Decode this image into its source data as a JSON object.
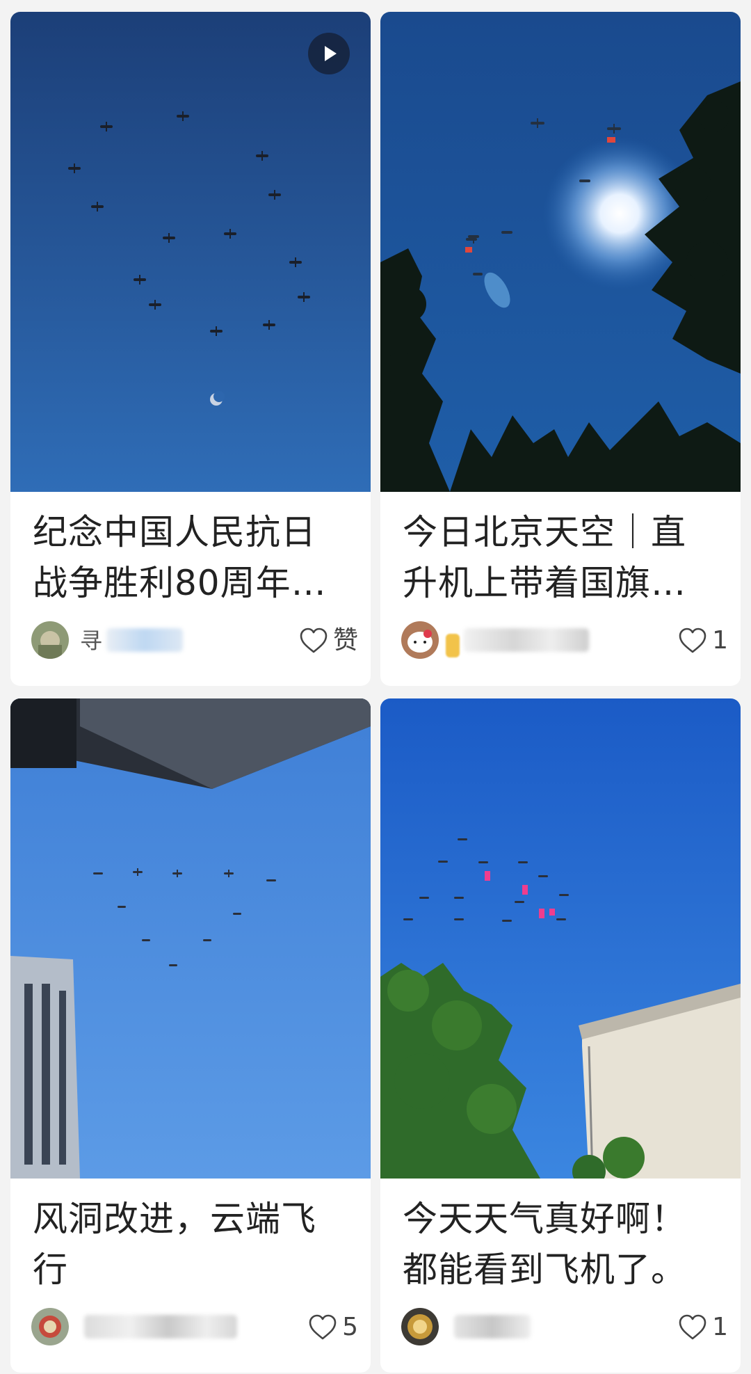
{
  "cards": [
    {
      "title_lines": [
        "纪念中国人民抗日",
        "战争胜利80周年…"
      ],
      "author": "寻",
      "like_label": "赞",
      "has_video": true
    },
    {
      "title_lines": [
        "今日北京天空｜直",
        "升机上带着国旗…"
      ],
      "author": "",
      "like_label": "1",
      "has_video": false
    },
    {
      "title_lines": [
        "风洞改进，云端飞",
        "行"
      ],
      "author": "",
      "like_label": "5",
      "has_video": false
    },
    {
      "title_lines": [
        "今天天气真好啊！",
        "都能看到飞机了。"
      ],
      "author": "",
      "like_label": "1",
      "has_video": false
    }
  ],
  "icons": {
    "like": "heart-outline-icon",
    "play": "play-icon"
  },
  "colors": {
    "card_bg": "#ffffff",
    "page_bg": "#f3f3f3",
    "title_text": "#222222",
    "meta_text": "#555555"
  }
}
